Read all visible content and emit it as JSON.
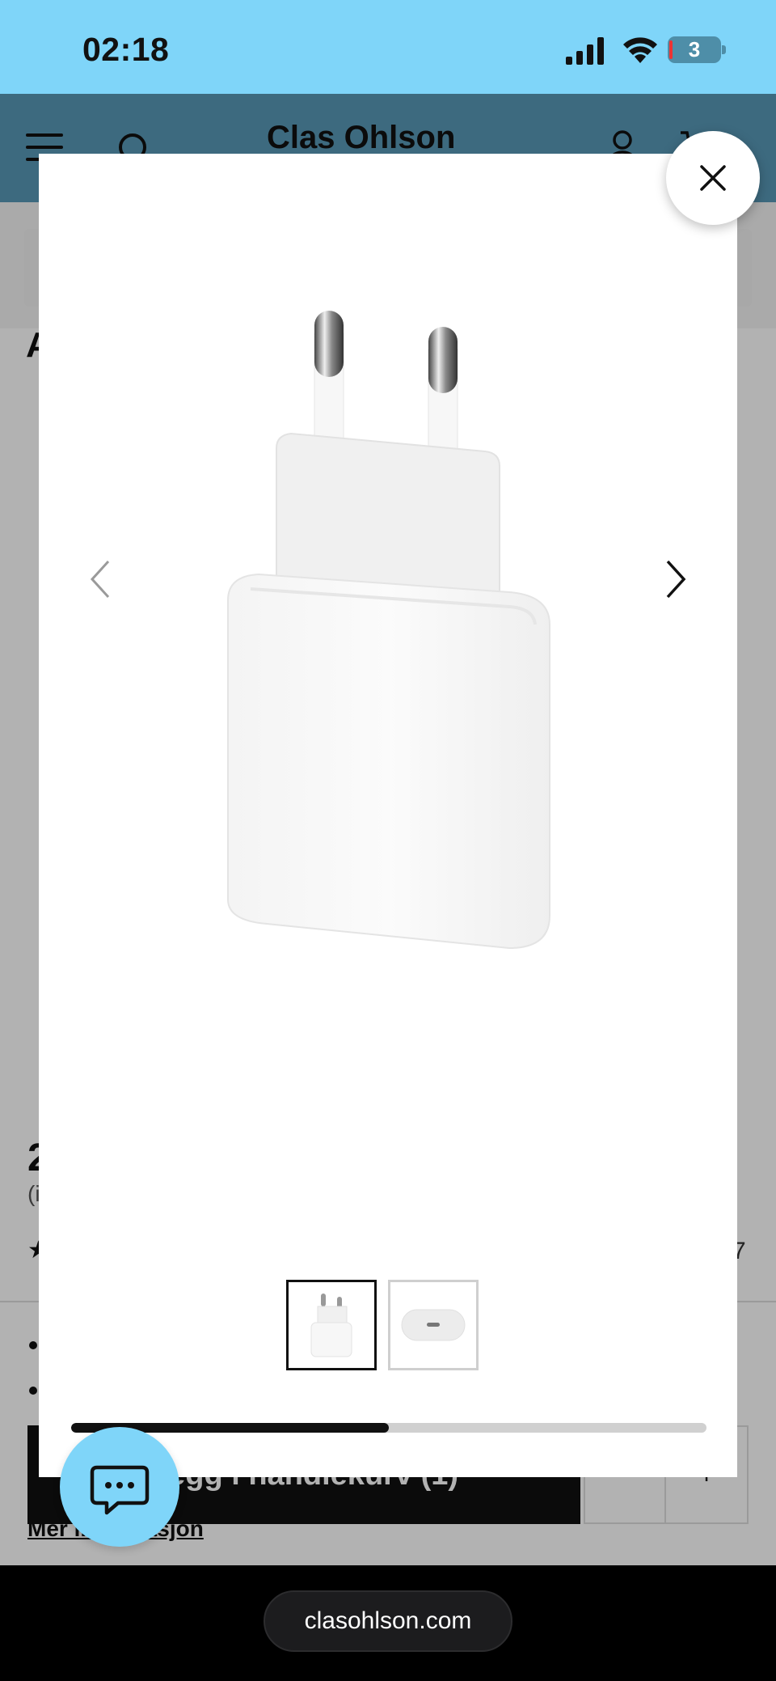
{
  "status_bar": {
    "time": "02:18",
    "battery": "3"
  },
  "header": {
    "logo": "Clas Ohlson"
  },
  "page_behind": {
    "product_title_partial": "A",
    "price_partial": "2",
    "price_sub_partial": "(i",
    "review_count_partial": "7",
    "add_to_cart_label": "Legg i handlekurv (1)",
    "qty_minus": "-",
    "qty_plus": "+",
    "more_info_link": "Mer informasjon"
  },
  "gallery": {
    "total_images": 2,
    "current_index": 1,
    "progress": 0.5,
    "thumbnails": [
      {
        "name": "charger-front",
        "selected": true
      },
      {
        "name": "usb-c-port",
        "selected": false
      }
    ]
  },
  "browser": {
    "url": "clasohlson.com"
  },
  "colors": {
    "status_bar": "#7fd5f9",
    "header": "#5899b6",
    "chat_fab": "#7fd5f9",
    "progress_fill": "#111111",
    "progress_track": "#d0d0d0"
  },
  "icons": {
    "close": "close-icon",
    "prev": "chevron-left-icon",
    "next": "chevron-right-icon",
    "chat": "chat-bubble-icon",
    "menu": "hamburger-menu-icon",
    "search": "search-icon",
    "account": "account-icon",
    "cart": "cart-icon"
  }
}
